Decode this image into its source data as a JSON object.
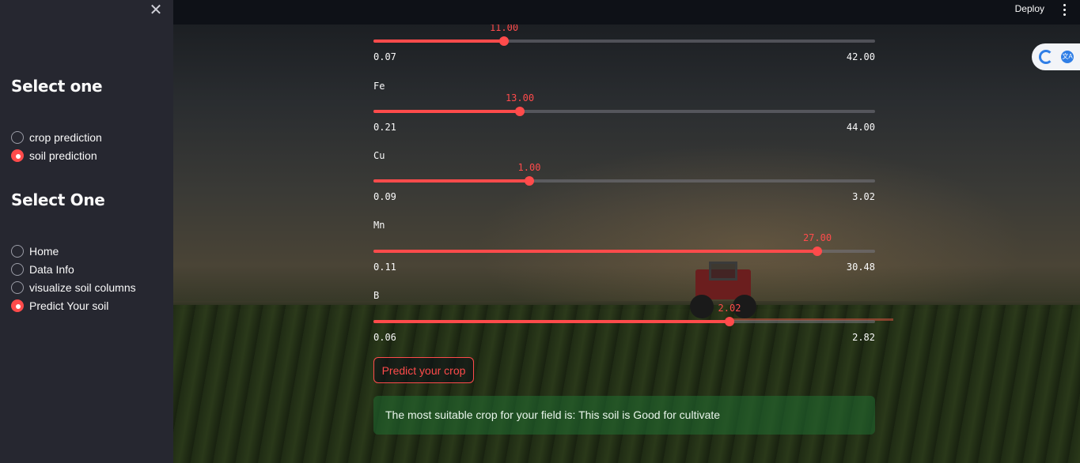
{
  "header": {
    "deploy_label": "Deploy",
    "menu_icon": "kebab-menu-icon"
  },
  "sidebar": {
    "close_icon": "close-icon",
    "close_glyph": "✕",
    "group1": {
      "title": "Select one",
      "options": [
        {
          "label": "crop prediction",
          "selected": false
        },
        {
          "label": "soil prediction",
          "selected": true
        }
      ]
    },
    "group2": {
      "title": "Select One",
      "options": [
        {
          "label": "Home",
          "selected": false
        },
        {
          "label": "Data Info",
          "selected": false
        },
        {
          "label": "visualize soil columns",
          "selected": false
        },
        {
          "label": "Predict Your soil",
          "selected": true
        }
      ]
    }
  },
  "sliders": [
    {
      "label": "",
      "value": "11.00",
      "min": "0.07",
      "max": "42.00"
    },
    {
      "label": "Fe",
      "value": "13.00",
      "min": "0.21",
      "max": "44.00"
    },
    {
      "label": "Cu",
      "value": "1.00",
      "min": "0.09",
      "max": "3.02"
    },
    {
      "label": "Mn",
      "value": "27.00",
      "min": "0.11",
      "max": "30.48"
    },
    {
      "label": "B",
      "value": "2.02",
      "min": "0.06",
      "max": "2.82"
    }
  ],
  "predict_button": "Predict your crop",
  "result_text": "The most suitable crop for your field is: This soil is Good for cultivate",
  "colors": {
    "accent": "#ff4b4b",
    "sidebar_bg": "#262730",
    "success_bg": "#216e32"
  },
  "extension": {
    "icon_a": "extension-logo-icon",
    "icon_b": "translate-icon",
    "icon_b_glyph": "文A"
  }
}
